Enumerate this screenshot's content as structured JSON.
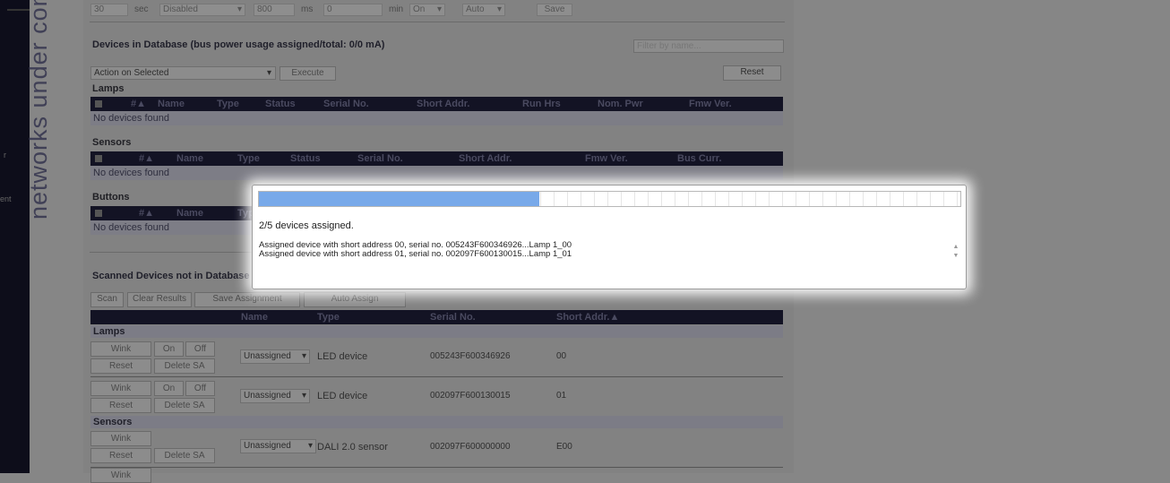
{
  "side": {
    "frag1": "r",
    "frag2": "ent",
    "vertical_text": "networks under cont"
  },
  "top_row": {
    "v1": "30",
    "u1": "sec",
    "v2": "Disabled",
    "v3": "800",
    "u3": "ms",
    "v4": "0",
    "u4": "min",
    "v5": "On",
    "v6": "Auto",
    "save": "Save"
  },
  "db": {
    "title": "Devices in Database (bus power usage assigned/total: 0/0 mA)",
    "filter_placeholder": "Filter by name...",
    "action_select": "Action on Selected",
    "execute": "Execute",
    "reset": "Reset",
    "lamps": {
      "label": "Lamps",
      "columns": [
        "#▲",
        "Name",
        "Type",
        "Status",
        "Serial No.",
        "Short Addr.",
        "Run Hrs",
        "Nom. Pwr",
        "Fmw Ver."
      ],
      "empty": "No devices found"
    },
    "sensors": {
      "label": "Sensors",
      "columns": [
        "#▲",
        "Name",
        "Type",
        "Status",
        "Serial No.",
        "Short Addr.",
        "Fmw Ver.",
        "Bus Curr."
      ],
      "empty": "No devices found"
    },
    "buttons": {
      "label": "Buttons",
      "columns": [
        "#▲",
        "Name",
        "Typ"
      ],
      "empty": "No devices found"
    }
  },
  "scanned": {
    "title": "Scanned Devices not in Database",
    "scan": "Scan",
    "clear": "Clear Results",
    "save_assign": "Save Assignment",
    "auto_assign": "Auto Assign",
    "columns": [
      "Name",
      "Type",
      "Serial No.",
      "Short Addr.▲"
    ],
    "lamps_label": "Lamps",
    "sensors_label": "Sensors",
    "rows": [
      {
        "wink": "Wink",
        "on": "On",
        "off": "Off",
        "reset": "Reset",
        "delete": "Delete SA",
        "name": "Unassigned",
        "type": "LED device",
        "serial": "005243F600346926",
        "addr": "00"
      },
      {
        "wink": "Wink",
        "on": "On",
        "off": "Off",
        "reset": "Reset",
        "delete": "Delete SA",
        "name": "Unassigned",
        "type": "LED device",
        "serial": "002097F600130015",
        "addr": "01"
      },
      {
        "wink": "Wink",
        "reset": "Reset",
        "delete": "Delete SA",
        "name": "Unassigned",
        "type": "DALI 2.0 sensor",
        "serial": "002097F600000000",
        "addr": "E00"
      }
    ],
    "partial_btn": "Wink"
  },
  "modal": {
    "progress": 0.4,
    "status": "2/5 devices assigned.",
    "log": [
      "Assigned device with short address 00, serial no. 005243F600346926...Lamp 1_00",
      "Assigned device with short address 01, serial no. 002097F600130015...Lamp 1_01"
    ]
  }
}
